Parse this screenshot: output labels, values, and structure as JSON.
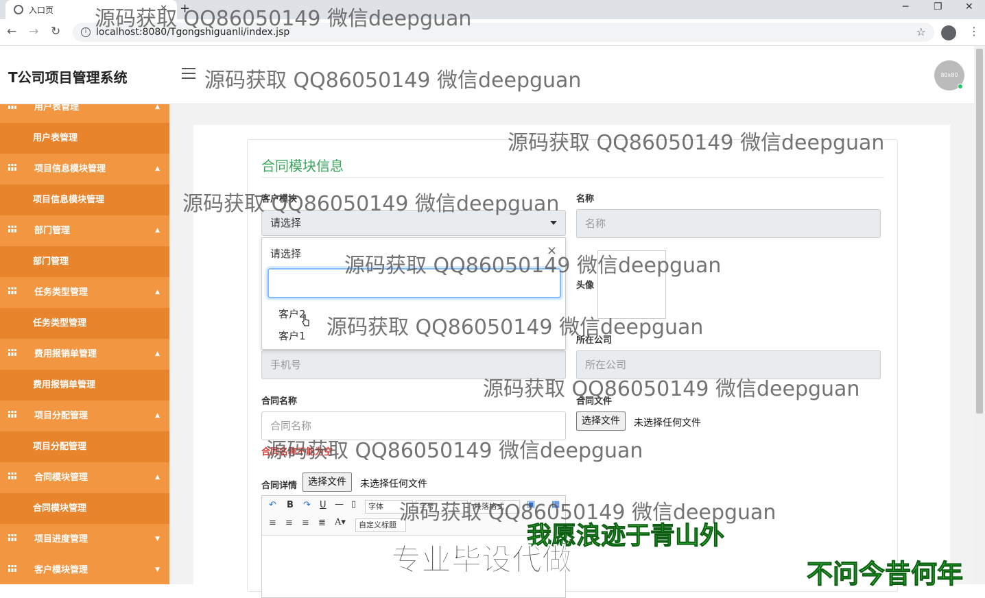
{
  "browser": {
    "tab_title": "入口页",
    "new_tab": "+",
    "url": "localhost:8080/Tgongshiguanli/index.jsp",
    "minimize": "─",
    "restore": "❐",
    "close": "✕"
  },
  "header": {
    "brand": "T公司项目管理系统",
    "avatar_text": "80x80"
  },
  "sidebar": {
    "items": [
      {
        "group": "用户表管理",
        "sub": "用户表管理",
        "chevron": "▲"
      },
      {
        "group": "项目信息模块管理",
        "sub": "项目信息模块管理",
        "chevron": "▲"
      },
      {
        "group": "部门管理",
        "sub": "部门管理",
        "chevron": "▲"
      },
      {
        "group": "任务类型管理",
        "sub": "任务类型管理",
        "chevron": "▲"
      },
      {
        "group": "费用报销单管理",
        "sub": "费用报销单管理",
        "chevron": "▲"
      },
      {
        "group": "项目分配管理",
        "sub": "项目分配管理",
        "chevron": "▲"
      },
      {
        "group": "合同模块管理",
        "sub": "合同模块管理",
        "chevron": "▲"
      },
      {
        "group": "项目进度管理",
        "chevron": "▼"
      },
      {
        "group": "客户模块管理",
        "chevron": "▼"
      }
    ]
  },
  "form": {
    "title": "合同模块信息",
    "customer_label": "客户模块",
    "customer_selected": "请选择",
    "dropdown": {
      "header": "请选择",
      "close": "×",
      "search_value": "",
      "options": [
        "客户2",
        "客户1"
      ]
    },
    "name_label": "名称",
    "name_placeholder": "名称",
    "avatar_label": "头像",
    "company_label": "所在公司",
    "company_placeholder": "所在公司",
    "phone_placeholder": "手机号",
    "contract_name_label": "合同名称",
    "contract_name_placeholder": "合同名称",
    "contract_name_error": "合同名称不能为空",
    "contract_file_label": "合同文件",
    "file_button": "选择文件",
    "file_status": "未选择任何文件",
    "contract_detail_label": "合同详情",
    "detail_file_button": "选择文件",
    "detail_file_status": "未选择任何文件",
    "editor": {
      "font_select": "字体",
      "size_select": "字号",
      "para_select": "段落格式",
      "custom_title": "自定义标题"
    }
  },
  "overlays": {
    "watermark": "源码获取 QQ86050149 微信deepguan",
    "sub1": "我愿浪迹于青山外",
    "sub2": "专业毕设代做",
    "sub3": "不问今昔何年"
  }
}
